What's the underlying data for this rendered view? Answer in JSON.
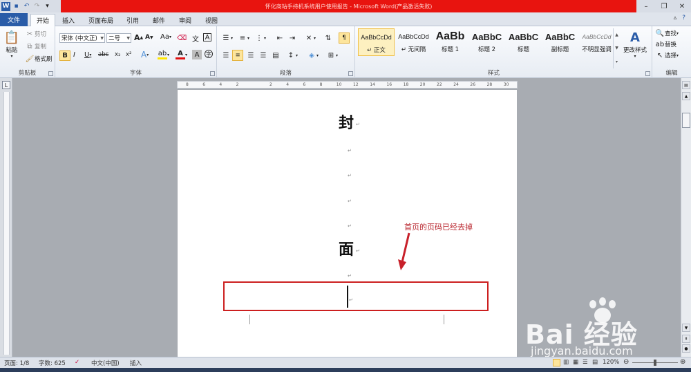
{
  "window": {
    "title": "怀化商站手持机系统用户使用报告 - Microsoft Word(产品激活失败)",
    "qat_icons": [
      "word-app-icon",
      "save-icon",
      "undo-icon",
      "redo-icon",
      "customize-qat-icon"
    ]
  },
  "tabs": [
    "文件",
    "开始",
    "插入",
    "页面布局",
    "引用",
    "邮件",
    "审阅",
    "视图"
  ],
  "active_tab": "开始",
  "clipboard": {
    "paste": "粘贴",
    "cut": "剪切",
    "copy": "复制",
    "format_painter": "格式刷",
    "label": "剪贴板"
  },
  "font": {
    "font_name": "宋体 (中文正)",
    "font_size": "二号",
    "label": "字体",
    "grow": "A",
    "shrink": "A",
    "change_case": "Aa",
    "bold": "B",
    "italic": "I",
    "underline": "U",
    "strike": "abc",
    "subscript": "x₂",
    "superscript": "x²",
    "clear": "A"
  },
  "paragraph": {
    "label": "段落"
  },
  "styles": {
    "label": "样式",
    "items": [
      {
        "preview": "AaBbCcDd",
        "name": "↵ 正文"
      },
      {
        "preview": "AaBbCcDd",
        "name": "↵ 无间隔"
      },
      {
        "preview": "AaBb",
        "name": "标题 1"
      },
      {
        "preview": "AaBbC",
        "name": "标题 2"
      },
      {
        "preview": "AaBbC",
        "name": "标题"
      },
      {
        "preview": "AaBbC",
        "name": "副标题"
      },
      {
        "preview": "AaBbCcDd",
        "name": "不明显强调"
      }
    ],
    "change_styles": "更改样式"
  },
  "editing": {
    "label": "编辑",
    "find": "查找",
    "replace": "替换",
    "select": "选择"
  },
  "ruler": {
    "ticks": [
      "8",
      "6",
      "4",
      "2",
      "",
      "2",
      "4",
      "6",
      "8",
      "10",
      "12",
      "14",
      "16",
      "18",
      "20",
      "22",
      "24",
      "26",
      "28",
      "30"
    ]
  },
  "document": {
    "char1": "封",
    "char2": "面",
    "para_mark": "↵"
  },
  "annotation": {
    "text": "首页的页码已经去掉"
  },
  "status": {
    "page": "页面: 1/8",
    "words": "字数: 625",
    "language": "中文(中国)",
    "mode": "插入",
    "zoom": "120%"
  },
  "watermark": {
    "logo": "Bai  经验",
    "url": "jingyan.baidu.com"
  }
}
